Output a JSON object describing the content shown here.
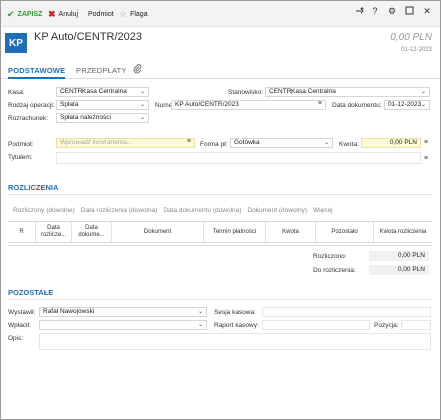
{
  "toolbar": {
    "save": "ZAPISZ",
    "cancel": "Anuluj",
    "contractor": "Podmiot",
    "flag": "Flaga",
    "right_icons": [
      "link-add-icon",
      "help-icon",
      "settings-icon",
      "restore-icon",
      "close-icon"
    ],
    "save_color": "#2a9d2a",
    "cancel_color": "#d02020"
  },
  "header": {
    "badge": "KP",
    "title": "KP Auto/CENTR/2023",
    "amount": "0,00 PLN",
    "date": "01-12-2023",
    "accent": "#1f6fb8"
  },
  "tabs": {
    "basic": "PODSTAWOWE",
    "prepayments": "PRZEDPŁATY"
  },
  "form": {
    "kasa_label": "Kasa:",
    "kasa_code": "CENTR",
    "kasa_name": "Kasa Centralna",
    "stanowisko_label": "Stanowisko:",
    "stanowisko_code": "CENTR",
    "stanowisko_name": "Kasa Centralna",
    "rodzaj_label": "Rodzaj operacji:",
    "rodzaj_value": "Spłata",
    "numer_label": "Numer:",
    "numer_value": "KP Auto/CENTR/2023",
    "data_dok_label": "Data dokumentu:",
    "data_dok_value": "01-12-2023",
    "rozrachunek_label": "Rozrachunek:",
    "rozrachunek_value": "Spłata należności",
    "podmiot_label": "Podmiot:",
    "podmiot_placeholder": "Wprowadź kontrahenta...",
    "forma_label": "Forma pł:",
    "forma_value": "Gotówka",
    "kwota_label": "Kwota:",
    "kwota_value": "0,00 PLN",
    "tytulem_label": "Tytułem:"
  },
  "rozliczenia": {
    "title": "ROZLICZENIA",
    "filters": [
      "Rozliczony (dowolne)",
      "Data rozliczenia (dowolna)",
      "Data dokumentu (dowolna)",
      "Dokument (dowolny)",
      "Więcej"
    ],
    "columns": [
      "R",
      "Data rozlicze...",
      "Data dokume...",
      "Dokument",
      "Termin płatności",
      "Kwota",
      "Pozostało",
      "Kwota rozliczenia"
    ],
    "rozliczono_label": "Rozliczono:",
    "rozliczono_value": "0,00 PLN",
    "do_rozliczenia_label": "Do rozliczenia:",
    "do_rozliczenia_value": "0,00 PLN"
  },
  "pozostale": {
    "title": "POZOSTAŁE",
    "wystawil_label": "Wystawił:",
    "wystawil_value": "Rafał Nawojowski",
    "sesja_label": "Sesja kasowa:",
    "wplacil_label": "Wpłacił:",
    "raport_label": "Raport kasowy:",
    "pozycja_label": "Pozycja:",
    "opis_label": "Opis:"
  }
}
